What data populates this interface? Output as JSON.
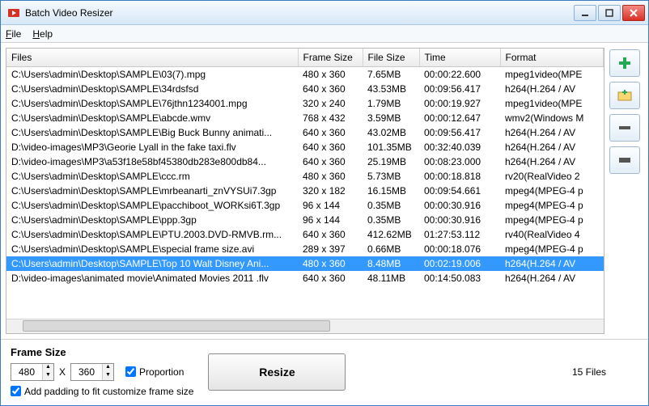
{
  "window": {
    "title": "Batch Video Resizer"
  },
  "menu": {
    "file": "File",
    "help": "Help"
  },
  "columns": [
    "Files",
    "Frame Size",
    "File Size",
    "Time",
    "Format"
  ],
  "rows": [
    {
      "file": "C:\\Users\\admin\\Desktop\\SAMPLE\\03(7).mpg",
      "fs": "480 x 360",
      "size": "7.65MB",
      "time": "00:00:22.600",
      "fmt": "mpeg1video(MPE"
    },
    {
      "file": "C:\\Users\\admin\\Desktop\\SAMPLE\\34rdsfsd",
      "fs": "640 x 360",
      "size": "43.53MB",
      "time": "00:09:56.417",
      "fmt": "h264(H.264 / AV"
    },
    {
      "file": "C:\\Users\\admin\\Desktop\\SAMPLE\\76jthn1234001.mpg",
      "fs": "320 x 240",
      "size": "1.79MB",
      "time": "00:00:19.927",
      "fmt": "mpeg1video(MPE"
    },
    {
      "file": "C:\\Users\\admin\\Desktop\\SAMPLE\\abcde.wmv",
      "fs": "768 x 432",
      "size": "3.59MB",
      "time": "00:00:12.647",
      "fmt": "wmv2(Windows M"
    },
    {
      "file": "C:\\Users\\admin\\Desktop\\SAMPLE\\Big Buck Bunny animati...",
      "fs": "640 x 360",
      "size": "43.02MB",
      "time": "00:09:56.417",
      "fmt": "h264(H.264 / AV"
    },
    {
      "file": "D:\\video-images\\MP3\\Georie Lyall in the fake taxi.flv",
      "fs": "640 x 360",
      "size": "101.35MB",
      "time": "00:32:40.039",
      "fmt": "h264(H.264 / AV"
    },
    {
      "file": "D:\\video-images\\MP3\\a53f18e58bf45380db283e800db84...",
      "fs": "640 x 360",
      "size": "25.19MB",
      "time": "00:08:23.000",
      "fmt": "h264(H.264 / AV"
    },
    {
      "file": "C:\\Users\\admin\\Desktop\\SAMPLE\\ccc.rm",
      "fs": "480 x 360",
      "size": "5.73MB",
      "time": "00:00:18.818",
      "fmt": "rv20(RealVideo 2"
    },
    {
      "file": "C:\\Users\\admin\\Desktop\\SAMPLE\\mrbeanarti_znVYSUi7.3gp",
      "fs": "320 x 182",
      "size": "16.15MB",
      "time": "00:09:54.661",
      "fmt": "mpeg4(MPEG-4 p"
    },
    {
      "file": "C:\\Users\\admin\\Desktop\\SAMPLE\\pacchiboot_WORKsi6T.3gp",
      "fs": "96 x 144",
      "size": "0.35MB",
      "time": "00:00:30.916",
      "fmt": "mpeg4(MPEG-4 p"
    },
    {
      "file": "C:\\Users\\admin\\Desktop\\SAMPLE\\ppp.3gp",
      "fs": "96 x 144",
      "size": "0.35MB",
      "time": "00:00:30.916",
      "fmt": "mpeg4(MPEG-4 p"
    },
    {
      "file": "C:\\Users\\admin\\Desktop\\SAMPLE\\PTU.2003.DVD-RMVB.rm...",
      "fs": "640 x 360",
      "size": "412.62MB",
      "time": "01:27:53.112",
      "fmt": "rv40(RealVideo 4"
    },
    {
      "file": "C:\\Users\\admin\\Desktop\\SAMPLE\\special frame size.avi",
      "fs": "289 x 397",
      "size": "0.66MB",
      "time": "00:00:18.076",
      "fmt": "mpeg4(MPEG-4 p"
    },
    {
      "file": "C:\\Users\\admin\\Desktop\\SAMPLE\\Top 10 Walt Disney Ani...",
      "fs": "480 x 360",
      "size": "8.48MB",
      "time": "00:02:19.006",
      "fmt": "h264(H.264 / AV",
      "selected": true
    },
    {
      "file": "D:\\video-images\\animated movie\\Animated Movies 2011 .flv",
      "fs": "640 x 360",
      "size": "48.11MB",
      "time": "00:14:50.083",
      "fmt": "h264(H.264 / AV"
    }
  ],
  "bottom": {
    "framesize_label": "Frame Size",
    "width": "480",
    "x": "X",
    "height": "360",
    "proportion": "Proportion",
    "padding": "Add padding to fit customize frame size",
    "resize": "Resize",
    "count": "15 Files"
  }
}
